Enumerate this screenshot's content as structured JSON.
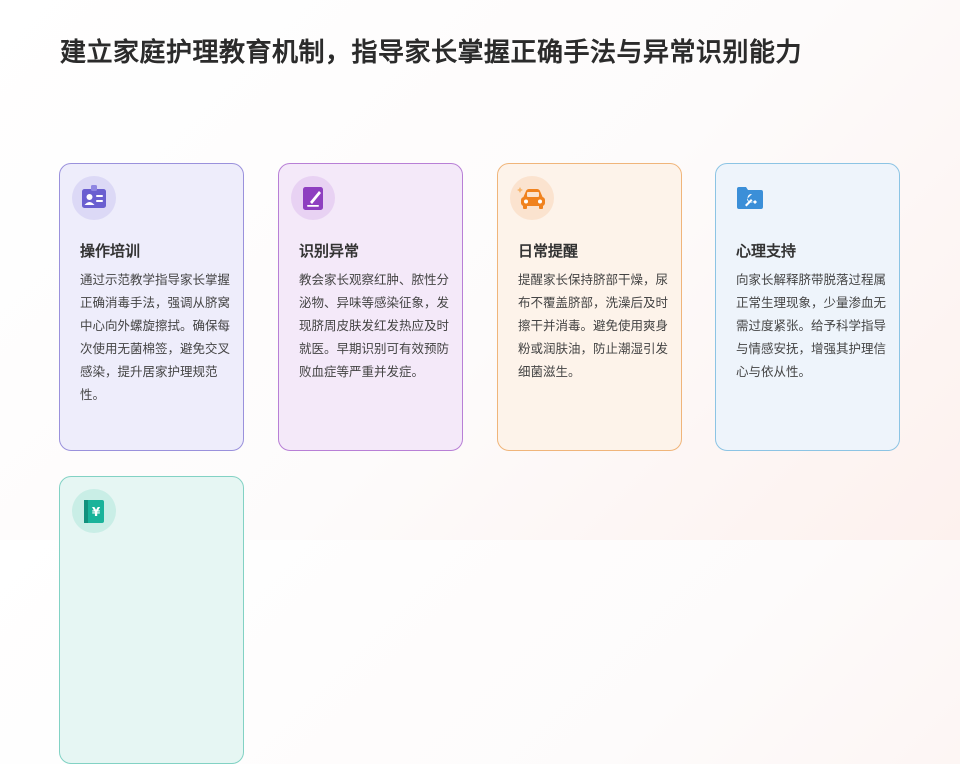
{
  "title": "建立家庭护理教育机制，指导家长掌握正确手法与异常识别能力",
  "cards": [
    {
      "title": "操作培训",
      "text": "通过示范教学指导家长掌握正确消毒手法，强调从脐窝中心向外螺旋擦拭。确保每次使用无菌棉签，避免交叉感染，提升居家护理规范性。",
      "icon": "id-badge-icon",
      "accent": "#6a5fd0"
    },
    {
      "title": "识别异常",
      "text": "教会家长观察红肿、脓性分泌物、异味等感染征象，发现脐周皮肤发红发热应及时就医。早期识别可有效预防败血症等严重并发症。",
      "icon": "pen-document-icon",
      "accent": "#8e3fc0"
    },
    {
      "title": "日常提醒",
      "text": "提醒家长保持脐部干燥，尿布不覆盖脐部，洗澡后及时擦干并消毒。避免使用爽身粉或润肤油，防止潮湿引发细菌滋生。",
      "icon": "car-icon",
      "accent": "#f0821e"
    },
    {
      "title": "心理支持",
      "text": "向家长解释脐带脱落过程属正常生理现象，少量渗血无需过度紧张。给予科学指导与情感安抚，增强其护理信心与依从性。",
      "icon": "wrench-folder-icon",
      "accent": "#3b8fd8"
    },
    {
      "title": "",
      "text": "",
      "icon": "yuan-book-icon",
      "accent": "#19b39a"
    }
  ]
}
